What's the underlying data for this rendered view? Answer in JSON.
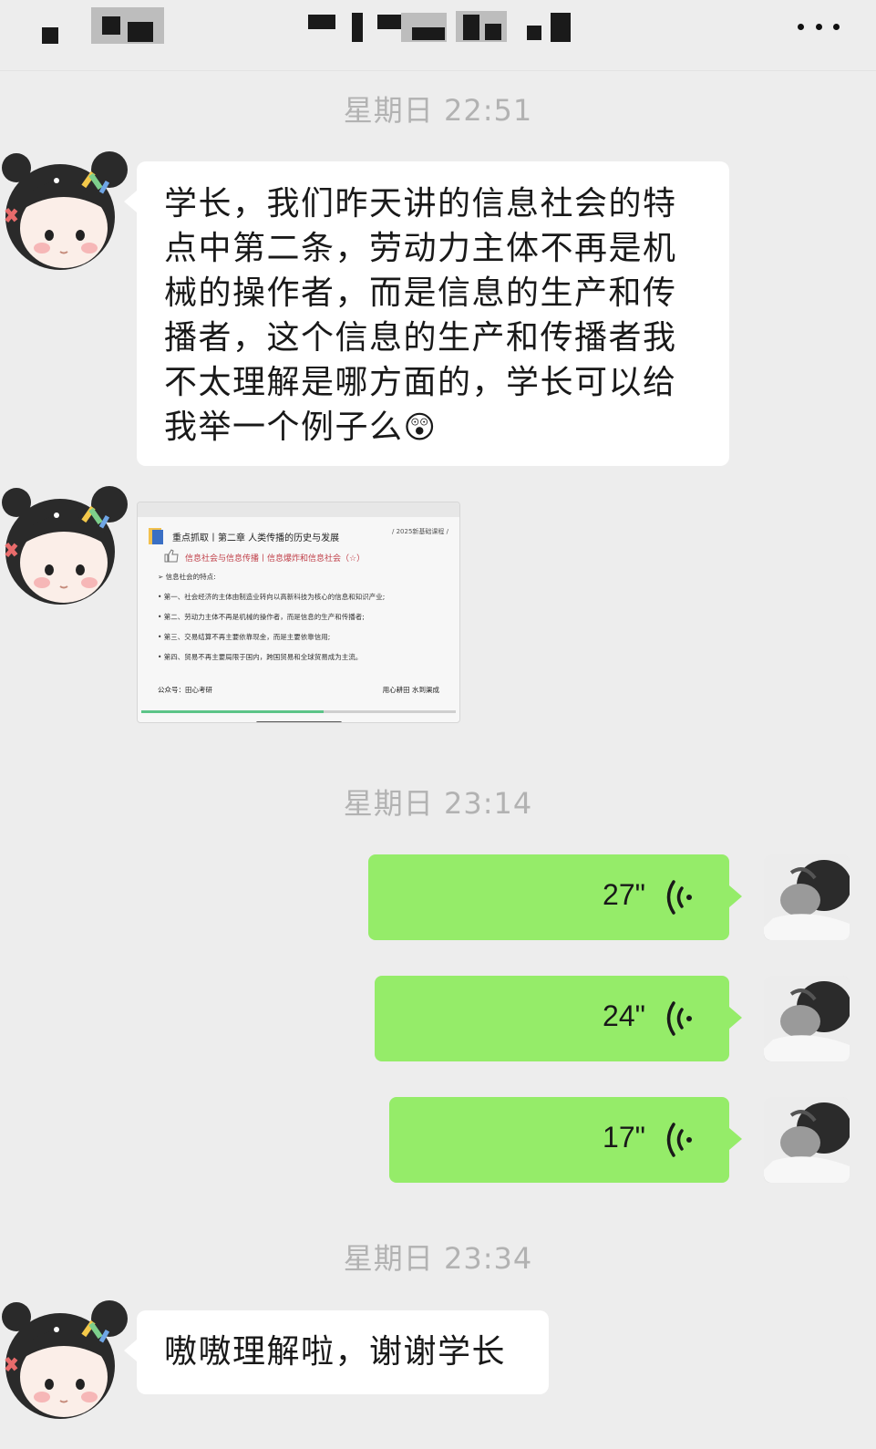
{
  "header": {
    "title_redacted": true,
    "more_icon": "more-icon"
  },
  "timestamps": [
    "星期日 22:51",
    "星期日 23:14",
    "星期日 23:34"
  ],
  "messages": {
    "question": "学长，我们昨天讲的信息社会的特点中第二条，劳动力主体不再是机械的操作者，而是信息的生产和传播者，这个信息的生产和传播者我不太理解是哪方面的，学长可以给我举一个例子么",
    "question_emoji": "😲",
    "reply": "嗷嗷理解啦，谢谢学长"
  },
  "voice_messages": [
    {
      "duration": "27\""
    },
    {
      "duration": "24\""
    },
    {
      "duration": "17\""
    }
  ],
  "image_message": {
    "title": "重点抓取丨第二章 人类传播的历史与发展",
    "tag": "/ 2025新基础课程 /",
    "subtitle": "信息社会与信息传播丨信息爆炸和信息社会（☆）",
    "lines": [
      "➢ 信息社会的特点:",
      "• 第一、社会经济的主体由制造业转向以高新科技为核心的信息和知识产业;",
      "• 第二、劳动力主体不再是机械的操作者，而是信息的生产和传播者;",
      "• 第三、交易结算不再主要依靠现金，而是主要依靠信用;",
      "• 第四、贸易不再主要局限于国内，跨国贸易和全球贸易成为主流。"
    ],
    "footer_left": "公众号：田心考研",
    "footer_right": "用心耕田 水到渠成",
    "progress": 0.58
  },
  "colors": {
    "background": "#ededed",
    "bubble_self": "#95ec69",
    "bubble_other": "#ffffff",
    "timestamp": "#b2b2b2"
  }
}
